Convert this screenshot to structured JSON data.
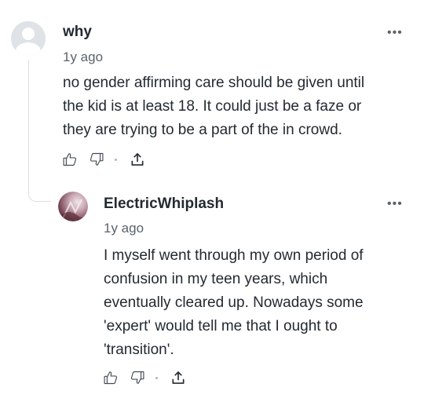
{
  "comments": [
    {
      "username": "why",
      "timestamp": "1y ago",
      "more_label": "•••",
      "body_lines": [
        "no gender affirming care should be given until",
        "the kid is at least 18. It could just be a faze or",
        "they are trying to be a part of the in crowd."
      ],
      "avatar": "default-user-avatar",
      "actions": [
        "thumbs-up-icon",
        "thumbs-down-icon",
        "share-icon"
      ]
    },
    {
      "username": "ElectricWhiplash",
      "timestamp": "1y ago",
      "more_label": "•••",
      "body_lines": [
        "I myself went through my own period of",
        "confusion in my teen years, which",
        "eventually cleared up. Nowadays some",
        "'expert' would tell me that I ought to",
        "'transition'."
      ],
      "avatar": "user-photo-avatar",
      "actions": [
        "thumbs-up-icon",
        "thumbs-down-icon",
        "share-icon"
      ]
    }
  ],
  "colors": {
    "text": "#232a31",
    "muted": "#5b636a",
    "icon": "#464e56",
    "thread_line": "#dcdfe3",
    "avatar_bg": "#dfe2e6"
  }
}
